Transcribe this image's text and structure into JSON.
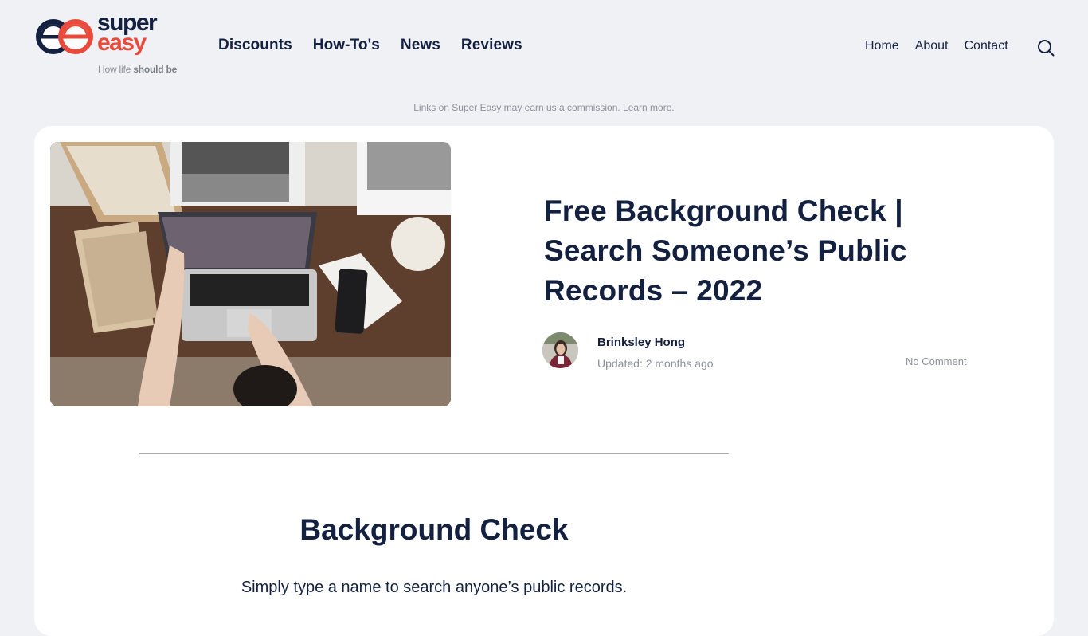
{
  "brand": {
    "name_line1": "super",
    "name_line2": "easy",
    "tagline_regular": "How life ",
    "tagline_bold": "should be",
    "colors": {
      "navy": "#13203f",
      "red": "#e84a3c"
    }
  },
  "main_nav": [
    {
      "label": "Discounts"
    },
    {
      "label": "How-To's"
    },
    {
      "label": "News"
    },
    {
      "label": "Reviews"
    }
  ],
  "secondary_nav": [
    {
      "label": "Home"
    },
    {
      "label": "About"
    },
    {
      "label": "Contact"
    }
  ],
  "search": {
    "icon": "search-icon"
  },
  "disclaimer": {
    "text": "Links on Super Easy may earn us a commission. ",
    "link": "Learn more."
  },
  "article": {
    "hero_image_alt": "Overhead view of a person using a laptop on a wooden desk with books, a phone and a notebook",
    "title": "Free Background Check | Search Someone’s Public Records – 2022",
    "author": "Brinksley Hong",
    "updated": "Updated: 2 months ago",
    "comments": "No Comment"
  },
  "section": {
    "heading": "Background Check",
    "subheading": "Simply type a name to search anyone’s public records."
  }
}
